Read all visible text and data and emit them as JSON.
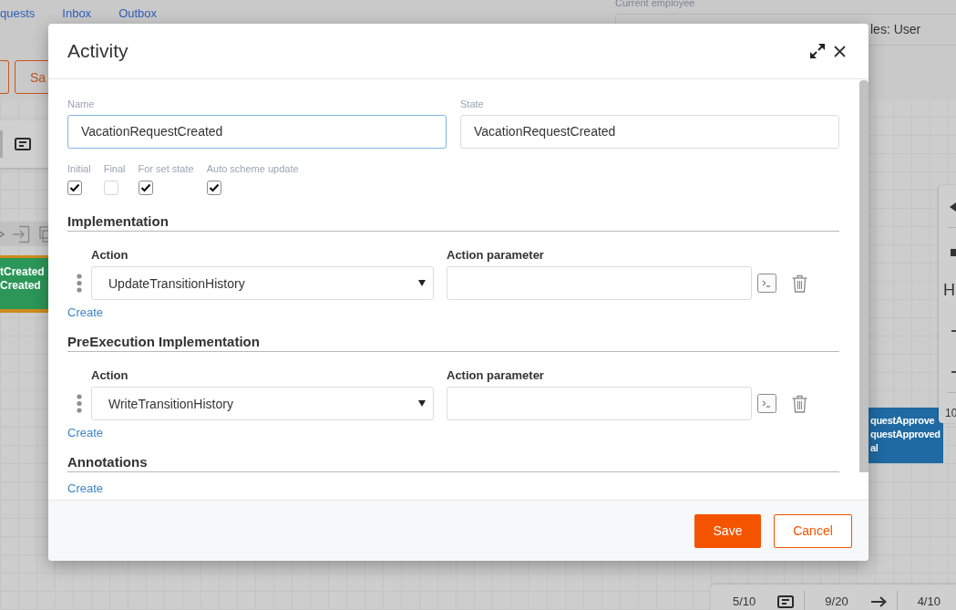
{
  "app": {
    "tabs": [
      "quests",
      "Inbox",
      "Outbox"
    ],
    "employee": {
      "label": "Current employee",
      "value": "les: User"
    },
    "toolbar_buttons": [
      "Sa"
    ]
  },
  "canvas": {
    "nodes": [
      {
        "lines": [
          "tCreated",
          "Created"
        ],
        "color": "#2b9658",
        "selected": true
      },
      {
        "lines": [
          "questApprove",
          "questApproved",
          "al"
        ],
        "color": "#1f6aa2",
        "selected": false
      }
    ],
    "side_panel": [
      "H",
      "10"
    ],
    "status_bar": [
      "5/10",
      "9/20",
      "4/10"
    ]
  },
  "dialog": {
    "title": "Activity",
    "fields": [
      {
        "label": "Name",
        "value": "VacationRequestCreated",
        "focused": true
      },
      {
        "label": "State",
        "value": "VacationRequestCreated",
        "focused": false
      }
    ],
    "flags": [
      {
        "label": "Initial",
        "checked": true
      },
      {
        "label": "Final",
        "checked": false
      },
      {
        "label": "For set state",
        "checked": true
      },
      {
        "label": "Auto scheme update",
        "checked": true
      }
    ],
    "sections": [
      {
        "title": "Implementation",
        "columns": [
          "Action",
          "Action parameter"
        ],
        "rows": [
          {
            "action": "UpdateTransitionHistory"
          }
        ],
        "create": "Create"
      },
      {
        "title": "PreExecution Implementation",
        "columns": [
          "Action",
          "Action parameter"
        ],
        "rows": [
          {
            "action": "WriteTransitionHistory"
          }
        ],
        "create": "Create"
      },
      {
        "title": "Annotations",
        "create": "Create"
      }
    ],
    "buttons": [
      {
        "label": "Save",
        "kind": "primary"
      },
      {
        "label": "Cancel",
        "kind": "secondary"
      }
    ]
  }
}
